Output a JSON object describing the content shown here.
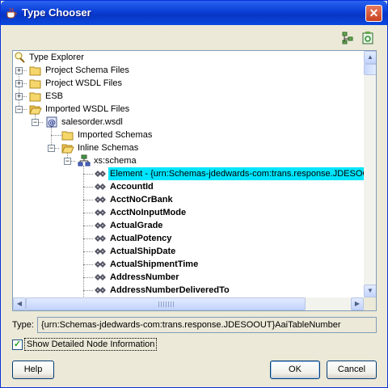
{
  "window": {
    "title": "Type Chooser",
    "close_glyph": "✕"
  },
  "toolbar": {
    "icons": [
      "tree-expand-icon",
      "schema-refresh-icon"
    ]
  },
  "tree": {
    "root": "Type Explorer",
    "project_schema": "Project Schema Files",
    "project_wsdl": "Project WSDL Files",
    "esb": "ESB",
    "imported_wsdl": "Imported WSDL Files",
    "salesorder": "salesorder.wsdl",
    "imported_schemas": "Imported Schemas",
    "inline_schemas": "Inline Schemas",
    "xs_schema": "xs:schema",
    "element": "Element - {urn:Schemas-jdedwards-com:trans.response.JDESOOUT}",
    "items": [
      "AccountId",
      "AcctNoCrBank",
      "AcctNoInputMode",
      "ActualGrade",
      "ActualPotency",
      "ActualShipDate",
      "ActualShipmentTime",
      "AddressNumber",
      "AddressNumberDeliveredTo"
    ]
  },
  "type_label": "Type:",
  "type_value": "{urn:Schemas-jdedwards-com:trans.response.JDESOOUT}AaiTableNumber",
  "show_detail": {
    "label": "Show Detailed Node Information",
    "checked": true
  },
  "buttons": {
    "help": "Help",
    "ok": "OK",
    "cancel": "Cancel"
  },
  "colors": {
    "title_bar": "#0a3ed6",
    "selection": "#00e5ff",
    "window_bg": "#ece9d8"
  }
}
